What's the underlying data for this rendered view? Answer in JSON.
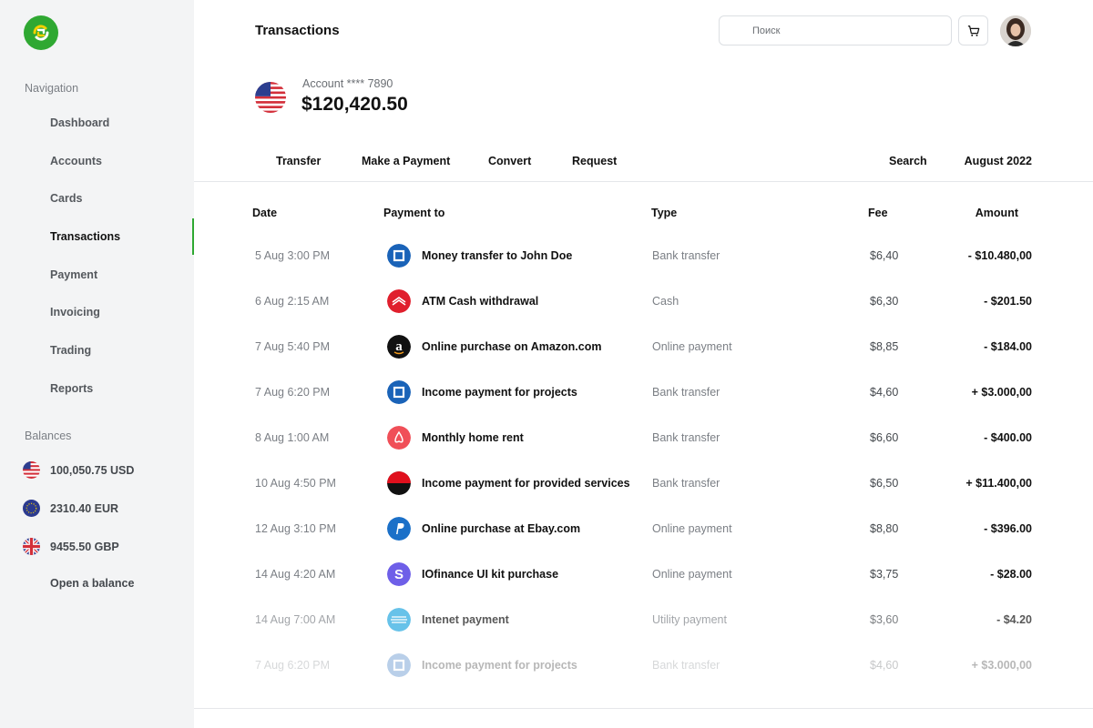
{
  "sidebar": {
    "navigation_heading": "Navigation",
    "nav_items": [
      {
        "label": "Dashboard"
      },
      {
        "label": "Accounts"
      },
      {
        "label": "Cards"
      },
      {
        "label": "Transactions"
      },
      {
        "label": "Payment"
      },
      {
        "label": "Invoicing"
      },
      {
        "label": "Trading"
      },
      {
        "label": "Reports"
      }
    ],
    "active_item": "Transactions",
    "balances_heading": "Balances",
    "balances": [
      {
        "label": "100,050.75 USD",
        "flag": "us-flag-icon"
      },
      {
        "label": "2310.40 EUR",
        "flag": "eu-flag-icon"
      },
      {
        "label": "9455.50 GBP",
        "flag": "uk-flag-icon"
      }
    ],
    "open_balance_label": "Open a balance"
  },
  "header": {
    "title": "Transactions",
    "search_placeholder": "Поиск",
    "cart_icon": "cart-icon",
    "avatar": "user-avatar"
  },
  "account": {
    "label": "Account **** 7890",
    "amount": "$120,420.50",
    "flag": "us-flag-icon"
  },
  "actions": {
    "transfer": "Transfer",
    "payment": "Make a Payment",
    "convert": "Convert",
    "request": "Request",
    "search": "Search",
    "period": "August 2022"
  },
  "table": {
    "headers": {
      "date": "Date",
      "payment_to": "Payment to",
      "type": "Type",
      "fee": "Fee",
      "amount": "Amount"
    },
    "rows": [
      {
        "date": "5 Aug 3:00 PM",
        "icon": "chase-bank-icon",
        "desc": "Money transfer to John Doe",
        "type": "Bank transfer",
        "fee": "$6,40",
        "amount": "- $10.480,00"
      },
      {
        "date": "6 Aug 2:15 AM",
        "icon": "bank-of-america-icon",
        "desc": "ATM Cash withdrawal",
        "type": "Cash",
        "fee": "$6,30",
        "amount": "- $201.50"
      },
      {
        "date": "7 Aug 5:40 PM",
        "icon": "amazon-icon",
        "desc": "Online purchase on Amazon.com",
        "type": "Online payment",
        "fee": "$8,85",
        "amount": "- $184.00"
      },
      {
        "date": "7 Aug 6:20 PM",
        "icon": "chase-bank-icon",
        "desc": "Income payment for projects",
        "type": "Bank transfer",
        "fee": "$4,60",
        "amount": "+ $3.000,00"
      },
      {
        "date": "8 Aug 1:00 AM",
        "icon": "airbnb-icon",
        "desc": "Monthly home rent",
        "type": "Bank transfer",
        "fee": "$6,60",
        "amount": "- $400.00"
      },
      {
        "date": "10 Aug 4:50 PM",
        "icon": "bank-half-circle-icon",
        "desc": "Income payment for provided services",
        "type": "Bank transfer",
        "fee": "$6,50",
        "amount": "+ $11.400,00"
      },
      {
        "date": "12 Aug 3:10 PM",
        "icon": "paypal-icon",
        "desc": "Online purchase at Ebay.com",
        "type": "Online payment",
        "fee": "$8,80",
        "amount": "- $396.00"
      },
      {
        "date": "14 Aug 4:20 AM",
        "icon": "stripe-icon",
        "desc": "IOfinance UI kit purchase",
        "type": "Online payment",
        "fee": "$3,75",
        "amount": "- $28.00"
      },
      {
        "date": "14 Aug 7:00 AM",
        "icon": "att-icon",
        "desc": "Intenet payment",
        "type": "Utility payment",
        "fee": "$3,60",
        "amount": "- $4.20"
      },
      {
        "date": "7 Aug 6:20 PM",
        "icon": "chase-bank-icon",
        "desc": "Income payment for projects",
        "type": "Bank transfer",
        "fee": "$4,60",
        "amount": "+ $3.000,00"
      }
    ],
    "row_opacities": [
      1,
      1,
      1,
      1,
      1,
      1,
      1,
      1,
      0.7,
      0.3
    ]
  },
  "colors": {
    "accent": "#2fa832",
    "sidebar_bg": "#f3f4f5"
  }
}
